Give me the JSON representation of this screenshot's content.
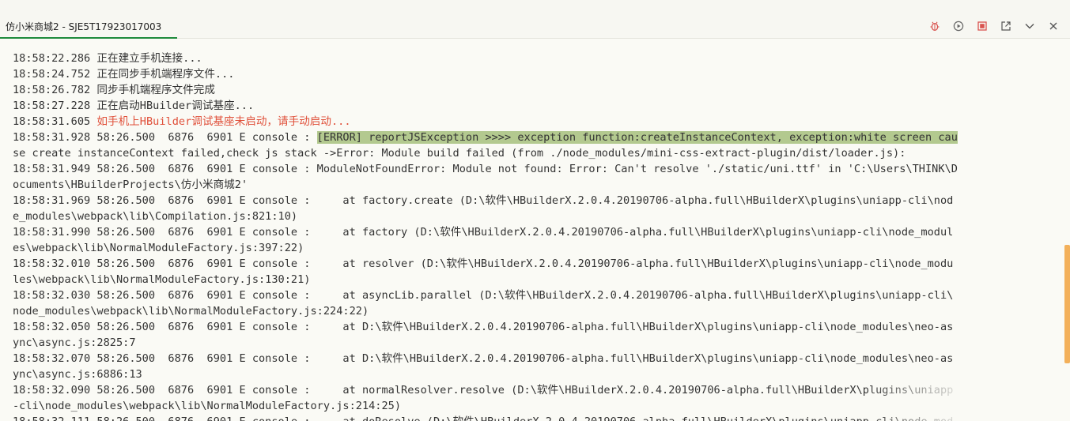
{
  "tab": {
    "title": "仿小米商城2 - SJE5T17923017003"
  },
  "toolbar": {
    "icons": [
      "bug-icon",
      "run-icon",
      "stop-icon",
      "export-icon",
      "chevron-down-icon",
      "close-icon"
    ],
    "accent_color": "#d9534f"
  },
  "console": {
    "lines": [
      {
        "text": "18:58:22.286 正在建立手机连接...",
        "style": "normal"
      },
      {
        "text": "18:58:24.752 正在同步手机端程序文件...",
        "style": "normal"
      },
      {
        "text": "18:58:26.782 同步手机端程序文件完成",
        "style": "normal"
      },
      {
        "text": "18:58:27.228 正在启动HBuilder调试基座...",
        "style": "normal"
      },
      {
        "prefix": "18:58:31.605 ",
        "text": "如手机上HBuilder调试基座未启动，请手动启动...",
        "style": "error"
      },
      {
        "prefix": "18:58:31.928 58:26.500  6876  6901 E console : ",
        "highlight": "[ERROR] reportJSException >>>> exception function:createInstanceContext, exception:white screen cau",
        "style": "highlight"
      },
      {
        "text": "se create instanceContext failed,check js stack ->Error: Module build failed (from ./node_modules/mini-css-extract-plugin/dist/loader.js):",
        "style": "normal"
      },
      {
        "text": "18:58:31.949 58:26.500  6876  6901 E console : ModuleNotFoundError: Module not found: Error: Can't resolve './static/uni.ttf' in 'C:\\Users\\THINK\\D",
        "style": "normal"
      },
      {
        "text": "ocuments\\HBuilderProjects\\仿小米商城2'",
        "style": "normal"
      },
      {
        "text": "18:58:31.969 58:26.500  6876  6901 E console :     at factory.create (D:\\软件\\HBuilderX.2.0.4.20190706-alpha.full\\HBuilderX\\plugins\\uniapp-cli\\nod",
        "style": "normal"
      },
      {
        "text": "e_modules\\webpack\\lib\\Compilation.js:821:10)",
        "style": "normal"
      },
      {
        "text": "18:58:31.990 58:26.500  6876  6901 E console :     at factory (D:\\软件\\HBuilderX.2.0.4.20190706-alpha.full\\HBuilderX\\plugins\\uniapp-cli\\node_modul",
        "style": "normal"
      },
      {
        "text": "es\\webpack\\lib\\NormalModuleFactory.js:397:22)",
        "style": "normal"
      },
      {
        "text": "18:58:32.010 58:26.500  6876  6901 E console :     at resolver (D:\\软件\\HBuilderX.2.0.4.20190706-alpha.full\\HBuilderX\\plugins\\uniapp-cli\\node_modu",
        "style": "normal"
      },
      {
        "text": "les\\webpack\\lib\\NormalModuleFactory.js:130:21)",
        "style": "normal"
      },
      {
        "text": "18:58:32.030 58:26.500  6876  6901 E console :     at asyncLib.parallel (D:\\软件\\HBuilderX.2.0.4.20190706-alpha.full\\HBuilderX\\plugins\\uniapp-cli\\",
        "style": "normal"
      },
      {
        "text": "node_modules\\webpack\\lib\\NormalModuleFactory.js:224:22)",
        "style": "normal"
      },
      {
        "text": "18:58:32.050 58:26.500  6876  6901 E console :     at D:\\软件\\HBuilderX.2.0.4.20190706-alpha.full\\HBuilderX\\plugins\\uniapp-cli\\node_modules\\neo-as",
        "style": "normal"
      },
      {
        "text": "ync\\async.js:2825:7",
        "style": "normal"
      },
      {
        "text": "18:58:32.070 58:26.500  6876  6901 E console :     at D:\\软件\\HBuilderX.2.0.4.20190706-alpha.full\\HBuilderX\\plugins\\uniapp-cli\\node_modules\\neo-as",
        "style": "normal"
      },
      {
        "text": "ync\\async.js:6886:13",
        "style": "normal"
      },
      {
        "text": "18:58:32.090 58:26.500  6876  6901 E console :     at normalResolver.resolve (D:\\软件\\HBuilderX.2.0.4.20190706-alpha.full\\HBuilderX\\plugins\\uniapp",
        "style": "normal"
      },
      {
        "text": "-cli\\node_modules\\webpack\\lib\\NormalModuleFactory.js:214:25)",
        "style": "normal"
      },
      {
        "text": "18:58:32.111 58:26.500  6876  6901 E console :     at doResolve (D:\\软件\\HBuilderX.2.0.4.20190706-alpha.full\\HBuilderX\\plugins\\uniapp-cli\\node_mod",
        "style": "normal"
      }
    ]
  }
}
